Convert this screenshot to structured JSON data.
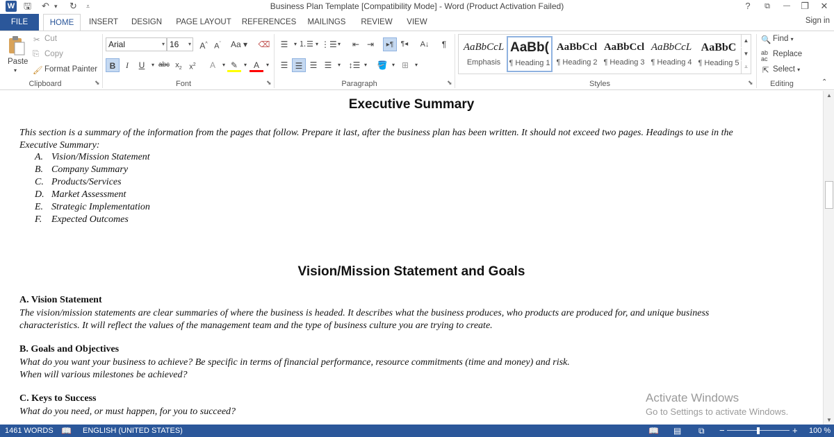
{
  "titlebar": {
    "title": "Business Plan Template [Compatibility Mode] - Word (Product Activation Failed)",
    "app_icon": "W",
    "help": "?",
    "ribbon_opts": "⧉",
    "minimize": "—",
    "restore": "❐",
    "close": "✕"
  },
  "tabs": {
    "file": "FILE",
    "items": [
      "HOME",
      "INSERT",
      "DESIGN",
      "PAGE LAYOUT",
      "REFERENCES",
      "MAILINGS",
      "REVIEW",
      "VIEW"
    ],
    "signin": "Sign in"
  },
  "ribbon": {
    "clipboard": {
      "label": "Clipboard",
      "paste": "Paste",
      "cut": "Cut",
      "copy": "Copy",
      "format_painter": "Format Painter"
    },
    "font": {
      "label": "Font",
      "font_name": "Arial",
      "font_size": "16"
    },
    "paragraph": {
      "label": "Paragraph"
    },
    "styles": {
      "label": "Styles",
      "items": [
        {
          "sample": "AaBbCcL",
          "name": "Emphasis"
        },
        {
          "sample": "AaBb(",
          "name": "¶ Heading 1"
        },
        {
          "sample": "AaBbCcl",
          "name": "¶ Heading 2"
        },
        {
          "sample": "AaBbCcl",
          "name": "¶ Heading 3"
        },
        {
          "sample": "AaBbCcL",
          "name": "¶ Heading 4"
        },
        {
          "sample": "AaBbC",
          "name": "¶ Heading 5"
        }
      ]
    },
    "editing": {
      "label": "Editing",
      "find": "Find",
      "replace": "Replace",
      "select": "Select"
    }
  },
  "document": {
    "h_exec": "Executive Summary",
    "exec_para_1": "This section is a summary of the information from the pages that follow. Prepare it last, after the business plan has been written. It should not exceed two pages. Headings to use in the",
    "exec_para_2": "Executive Summary:",
    "list": [
      {
        "marker": "A.",
        "text": "Vision/Mission Statement"
      },
      {
        "marker": "B.",
        "text": "Company Summary"
      },
      {
        "marker": "C.",
        "text": "Products/Services"
      },
      {
        "marker": "D.",
        "text": "Market Assessment"
      },
      {
        "marker": "E.",
        "text": "Strategic Implementation"
      },
      {
        "marker": "F.",
        "text": "Expected Outcomes"
      }
    ],
    "h_vision": "Vision/Mission Statement and Goals",
    "sub_a": "A. Vision Statement",
    "a_para_1": "The vision/mission statements are clear summaries of where the business is headed. It describes what the business produces, who products are produced for, and unique business",
    "a_para_2": "characteristics. It will reflect the values of the management team and the type of business culture you are trying to create.",
    "sub_b": "B. Goals and Objectives",
    "b_para_1": "What do you want your business to achieve? Be specific in terms of financial performance, resource commitments (time and money) and risk.",
    "b_para_2": "When will various milestones be achieved?",
    "sub_c": "C. Keys to Success",
    "c_para_1": "What do you need, or must happen, for you to succeed?"
  },
  "watermark": {
    "line1": "Activate Windows",
    "line2": "Go to Settings to activate Windows."
  },
  "statusbar": {
    "words": "1461 WORDS",
    "language": "ENGLISH (UNITED STATES)",
    "zoom": "100 %",
    "zoom_level_percent": 100
  },
  "colors": {
    "accent": "#2b579a"
  }
}
